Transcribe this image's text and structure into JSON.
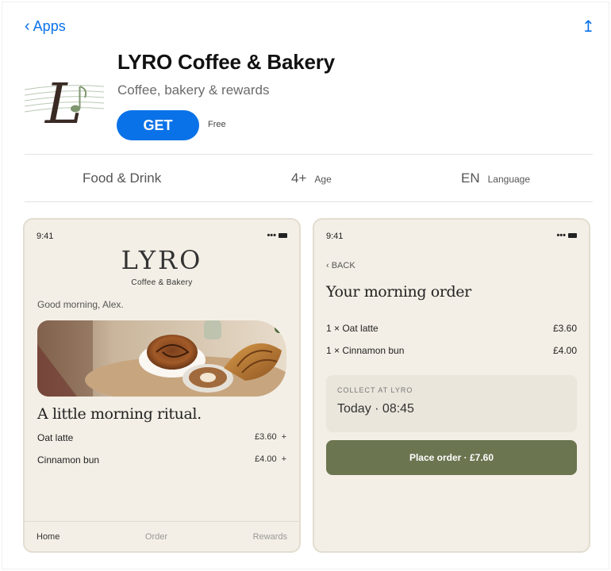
{
  "nav": {
    "back_label": "Apps",
    "back_chevron": "‹",
    "share_icon": "↥"
  },
  "app": {
    "title": "LYRO Coffee & Bakery",
    "subtitle": "Coffee, bakery & rewards",
    "get_label": "GET",
    "price": "Free",
    "icon_letter": "L",
    "icon": "music-note-l-logo"
  },
  "info": {
    "category": "Food & Drink",
    "age_value": "4+",
    "age_label": "Age",
    "lang_value": "EN",
    "lang_label": "Language"
  },
  "screen1": {
    "time": "9:41",
    "status": "•••",
    "logo": "LYRO",
    "logo_sub": "Coffee & Bakery",
    "greeting": "Good morning, Alex.",
    "heading": "A little morning ritual.",
    "items": [
      {
        "name": "Oat latte",
        "price": "£3.60",
        "plus": "+"
      },
      {
        "name": "Cinnamon bun",
        "price": "£4.00",
        "plus": "+"
      }
    ],
    "tabs": {
      "home": "Home",
      "order": "Order",
      "rewards": "Rewards"
    }
  },
  "screen2": {
    "time": "9:41",
    "status": "•••",
    "back": "‹ BACK",
    "title": "Your morning order",
    "items": [
      {
        "name": "1 × Oat latte",
        "price": "£3.60"
      },
      {
        "name": "1 × Cinnamon bun",
        "price": "£4.00"
      }
    ],
    "collect_label": "COLLECT AT LYRO",
    "collect_value": "Today · 08:45",
    "place_order": "Place order · £7.60"
  },
  "colors": {
    "accent": "#0a72e8",
    "olive": "#6b7550",
    "cream": "#f4efe6"
  }
}
